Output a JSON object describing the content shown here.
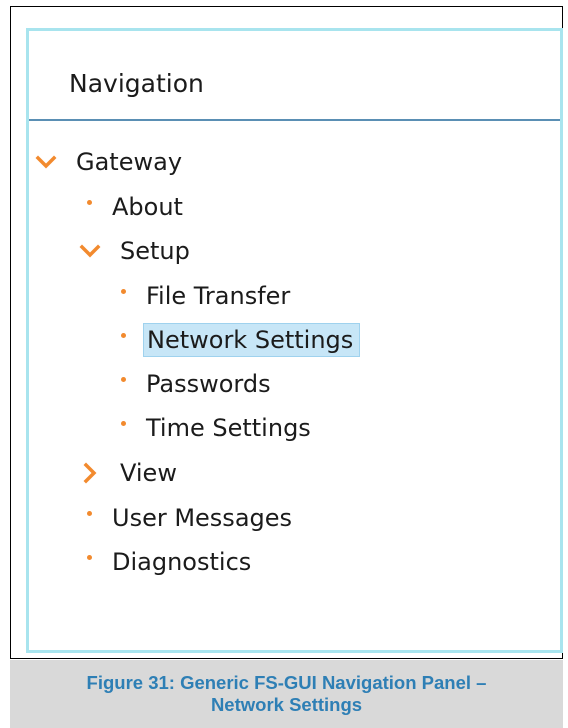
{
  "panel": {
    "title": "Navigation"
  },
  "tree": {
    "gateway": "Gateway",
    "about": "About",
    "setup": "Setup",
    "file_transfer": "File Transfer",
    "network_settings": "Network Settings",
    "passwords": "Passwords",
    "time_settings": "Time Settings",
    "view": "View",
    "user_messages": "User Messages",
    "diagnostics": "Diagnostics"
  },
  "selected_item": "Network Settings",
  "icons": {
    "expanded": "chevron-down-icon",
    "collapsed": "chevron-right-icon",
    "leaf": "bullet-icon"
  },
  "colors": {
    "accent": "#f28a2e",
    "selection": "#c7e6f7",
    "panel_border": "#a8e4ee",
    "header_rule": "#5a8fb4",
    "caption_text": "#2e7fb5",
    "caption_bg": "#d9d9d9"
  },
  "caption": {
    "line1": "Figure 31: Generic FS-GUI Navigation Panel –",
    "line2": "Network Settings"
  }
}
